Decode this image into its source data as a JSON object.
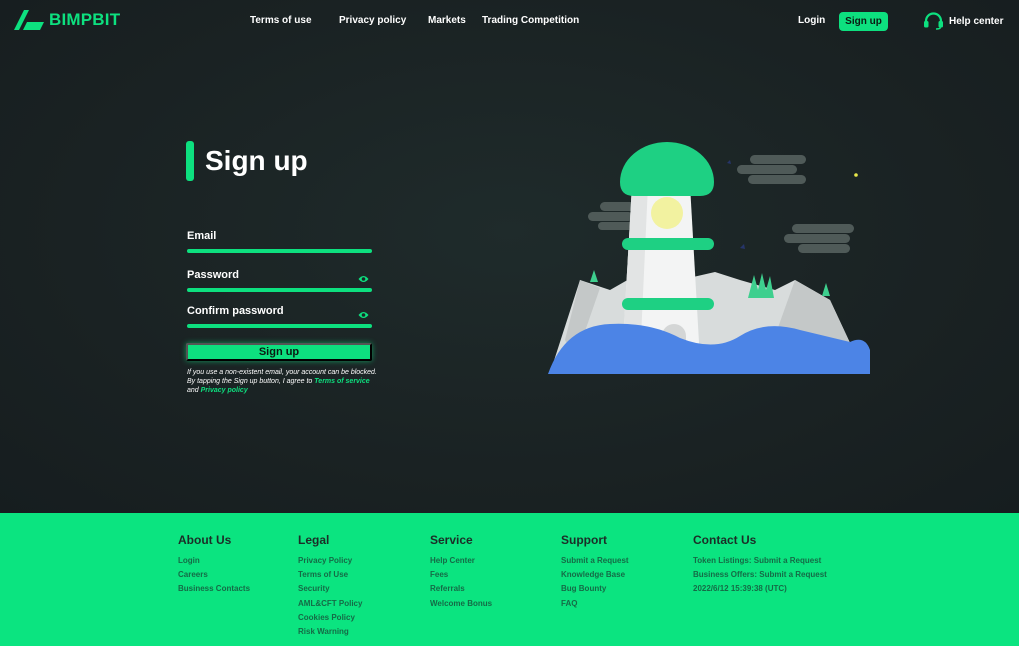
{
  "brand": {
    "name": "BIMPBIT",
    "accent": "#0de07f",
    "background": "#1c2426",
    "footer_bg": "#0be480"
  },
  "nav": {
    "links": [
      "Terms of use",
      "Privacy policy",
      "Markets",
      "Trading Competition"
    ],
    "login": "Login",
    "signup": "Sign up",
    "help": "Help center"
  },
  "form": {
    "title": "Sign up",
    "email_label": "Email",
    "password_label": "Password",
    "confirm_label": "Confirm password",
    "submit": "Sign up",
    "notice_text": "If you use a non-existent email, your account can be blocked. By tapping the Sign up button, I agree to",
    "terms_link": "Terms of service",
    "and_text": "and",
    "privacy_link": "Privacy policy"
  },
  "footer": {
    "columns": [
      {
        "title": "About Us",
        "items": [
          "Login",
          "Careers",
          "Business Contacts"
        ]
      },
      {
        "title": "Legal",
        "items": [
          "Privacy Policy",
          "Terms of Use",
          "Security",
          "AML&CFT Policy",
          "Cookies Policy",
          "Risk Warning"
        ]
      },
      {
        "title": "Service",
        "items": [
          "Help Center",
          "Fees",
          "Referrals",
          "Welcome Bonus"
        ]
      },
      {
        "title": "Support",
        "items": [
          "Submit a Request",
          "Knowledge Base",
          "Bug Bounty",
          "FAQ"
        ]
      },
      {
        "title": "Contact Us",
        "items": [
          "Token Listings: Submit a Request",
          "Business Offers: Submit a Request",
          "2022/6/12 15:39:38 (UTC)"
        ]
      }
    ]
  },
  "icons": [
    "logo-mark-icon",
    "headset-icon",
    "eye-icon",
    "lighthouse-illustration"
  ]
}
